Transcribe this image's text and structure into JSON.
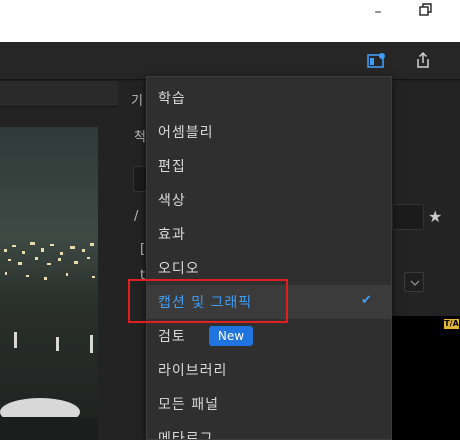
{
  "window": {
    "minimize_glyph": "–",
    "restore_icon": "restore-icon"
  },
  "toolbar": {
    "workspace_icon": "workspace-panel-icon",
    "share_icon": "share-export-icon"
  },
  "right_panel": {
    "label_a": "기",
    "label_b": "척",
    "label_c": "/",
    "label_d": "[",
    "label_e": "t"
  },
  "program_monitor": {
    "badge": "T/A"
  },
  "menu": {
    "items": [
      {
        "label": "학습"
      },
      {
        "label": "어셈블리"
      },
      {
        "label": "편집"
      },
      {
        "label": "색상"
      },
      {
        "label": "효과"
      },
      {
        "label": "오디오"
      },
      {
        "label": "캡션 및 그래픽",
        "checked": true
      },
      {
        "label": "검토",
        "badge": "New"
      },
      {
        "label": "라이브러리"
      },
      {
        "label": "모든 패널"
      },
      {
        "label": "메타로그"
      }
    ]
  },
  "colors": {
    "accent": "#3e9df7",
    "badge_bg": "#1f74e0",
    "highlight": "#e02020"
  }
}
